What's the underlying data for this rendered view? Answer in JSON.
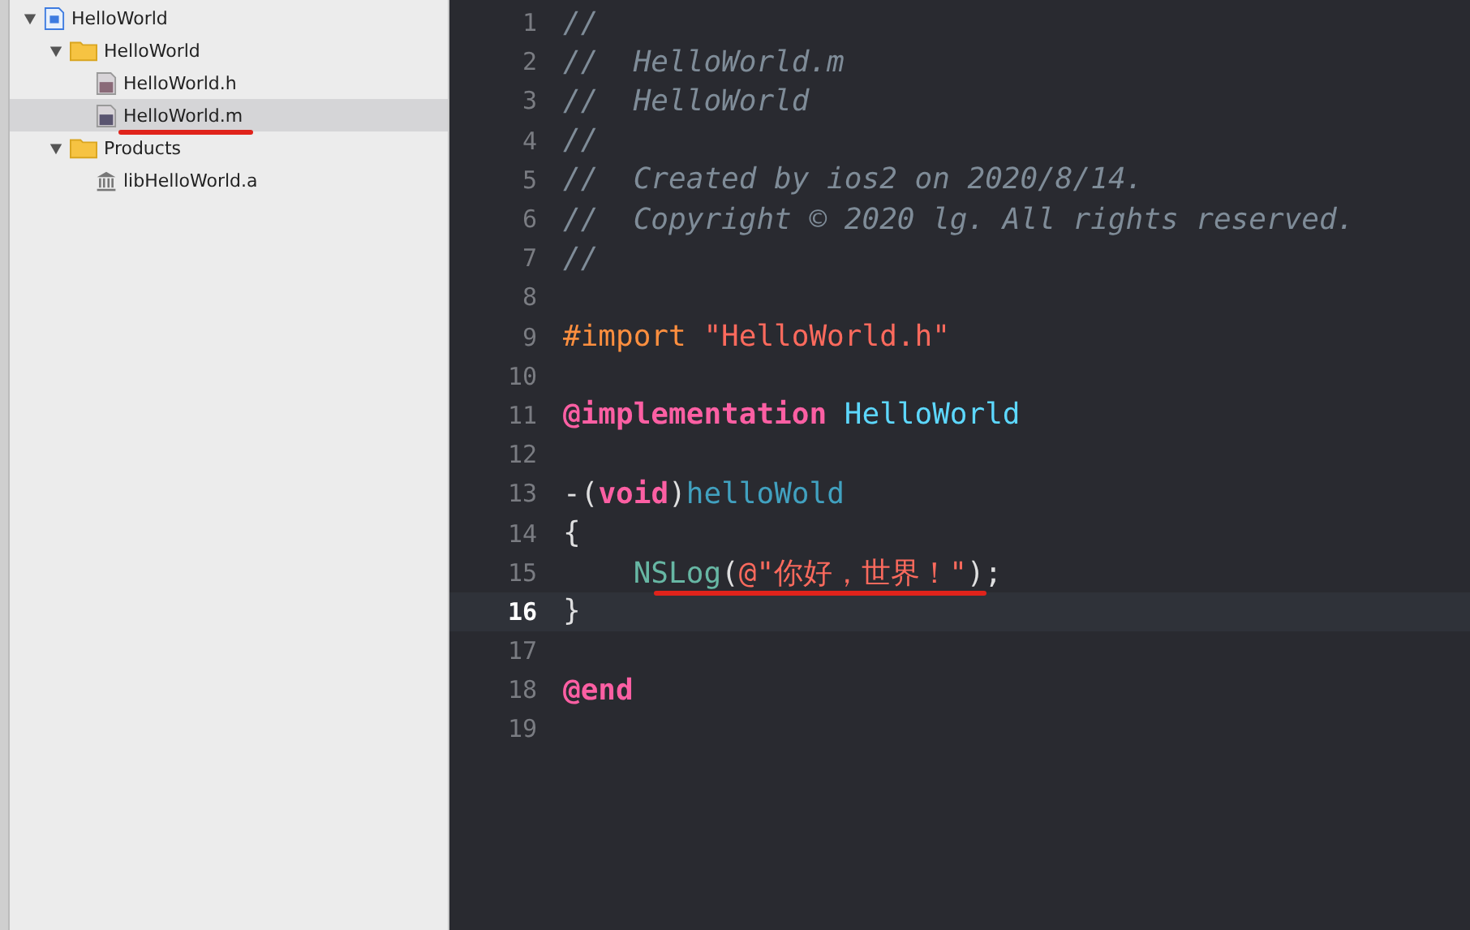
{
  "navigator": {
    "items": [
      {
        "label": "HelloWorld",
        "kind": "project",
        "expanded": true,
        "selected": false,
        "children": [
          {
            "label": "HelloWorld",
            "kind": "folder",
            "expanded": true,
            "selected": false,
            "children": [
              {
                "label": "HelloWorld.h",
                "kind": "header",
                "selected": false
              },
              {
                "label": "HelloWorld.m",
                "kind": "source",
                "selected": true,
                "underlined": true
              }
            ]
          },
          {
            "label": "Products",
            "kind": "folder",
            "expanded": true,
            "selected": false,
            "children": [
              {
                "label": "libHelloWorld.a",
                "kind": "library",
                "selected": false
              }
            ]
          }
        ]
      }
    ]
  },
  "editor": {
    "lines": [
      {
        "number": "1",
        "current": false,
        "tokens": [
          {
            "kind": "comment",
            "text": "//"
          }
        ]
      },
      {
        "number": "2",
        "current": false,
        "tokens": [
          {
            "kind": "comment",
            "text": "//  HelloWorld.m"
          }
        ]
      },
      {
        "number": "3",
        "current": false,
        "tokens": [
          {
            "kind": "comment",
            "text": "//  HelloWorld"
          }
        ]
      },
      {
        "number": "4",
        "current": false,
        "tokens": [
          {
            "kind": "comment",
            "text": "//"
          }
        ]
      },
      {
        "number": "5",
        "current": false,
        "tokens": [
          {
            "kind": "comment",
            "text": "//  Created by ios2 on 2020/8/14."
          }
        ]
      },
      {
        "number": "6",
        "current": false,
        "tokens": [
          {
            "kind": "comment",
            "text": "//  Copyright © 2020 lg. All rights reserved."
          }
        ]
      },
      {
        "number": "7",
        "current": false,
        "tokens": [
          {
            "kind": "comment",
            "text": "//"
          }
        ]
      },
      {
        "number": "8",
        "current": false
      },
      {
        "number": "9",
        "current": false,
        "tokens": [
          {
            "kind": "preprocessor",
            "text": "#import "
          },
          {
            "kind": "string",
            "text": "\"HelloWorld.h\""
          }
        ]
      },
      {
        "number": "10",
        "current": false
      },
      {
        "number": "11",
        "current": false,
        "tokens": [
          {
            "kind": "keyword",
            "text": "@implementation "
          },
          {
            "kind": "class",
            "text": "HelloWorld"
          }
        ]
      },
      {
        "number": "12",
        "current": false
      },
      {
        "number": "13",
        "current": false,
        "tokens": [
          {
            "kind": "plain",
            "text": "-("
          },
          {
            "kind": "keyword",
            "text": "void"
          },
          {
            "kind": "plain",
            "text": ")"
          },
          {
            "kind": "method",
            "text": "helloWold"
          }
        ]
      },
      {
        "number": "14",
        "current": false,
        "tokens": [
          {
            "kind": "plain",
            "text": "{"
          }
        ]
      },
      {
        "number": "15",
        "current": false,
        "underlined": true,
        "tokens": [
          {
            "kind": "function",
            "text": "    NSLog"
          },
          {
            "kind": "plain",
            "text": "("
          },
          {
            "kind": "string",
            "text": "@\"你好，世界！\""
          },
          {
            "kind": "plain",
            "text": ");"
          }
        ]
      },
      {
        "number": "16",
        "current": true,
        "tokens": [
          {
            "kind": "plain",
            "text": "}"
          }
        ]
      },
      {
        "number": "17",
        "current": false
      },
      {
        "number": "18",
        "current": false,
        "tokens": [
          {
            "kind": "keyword",
            "text": "@end"
          }
        ]
      },
      {
        "number": "19",
        "current": false
      }
    ]
  }
}
